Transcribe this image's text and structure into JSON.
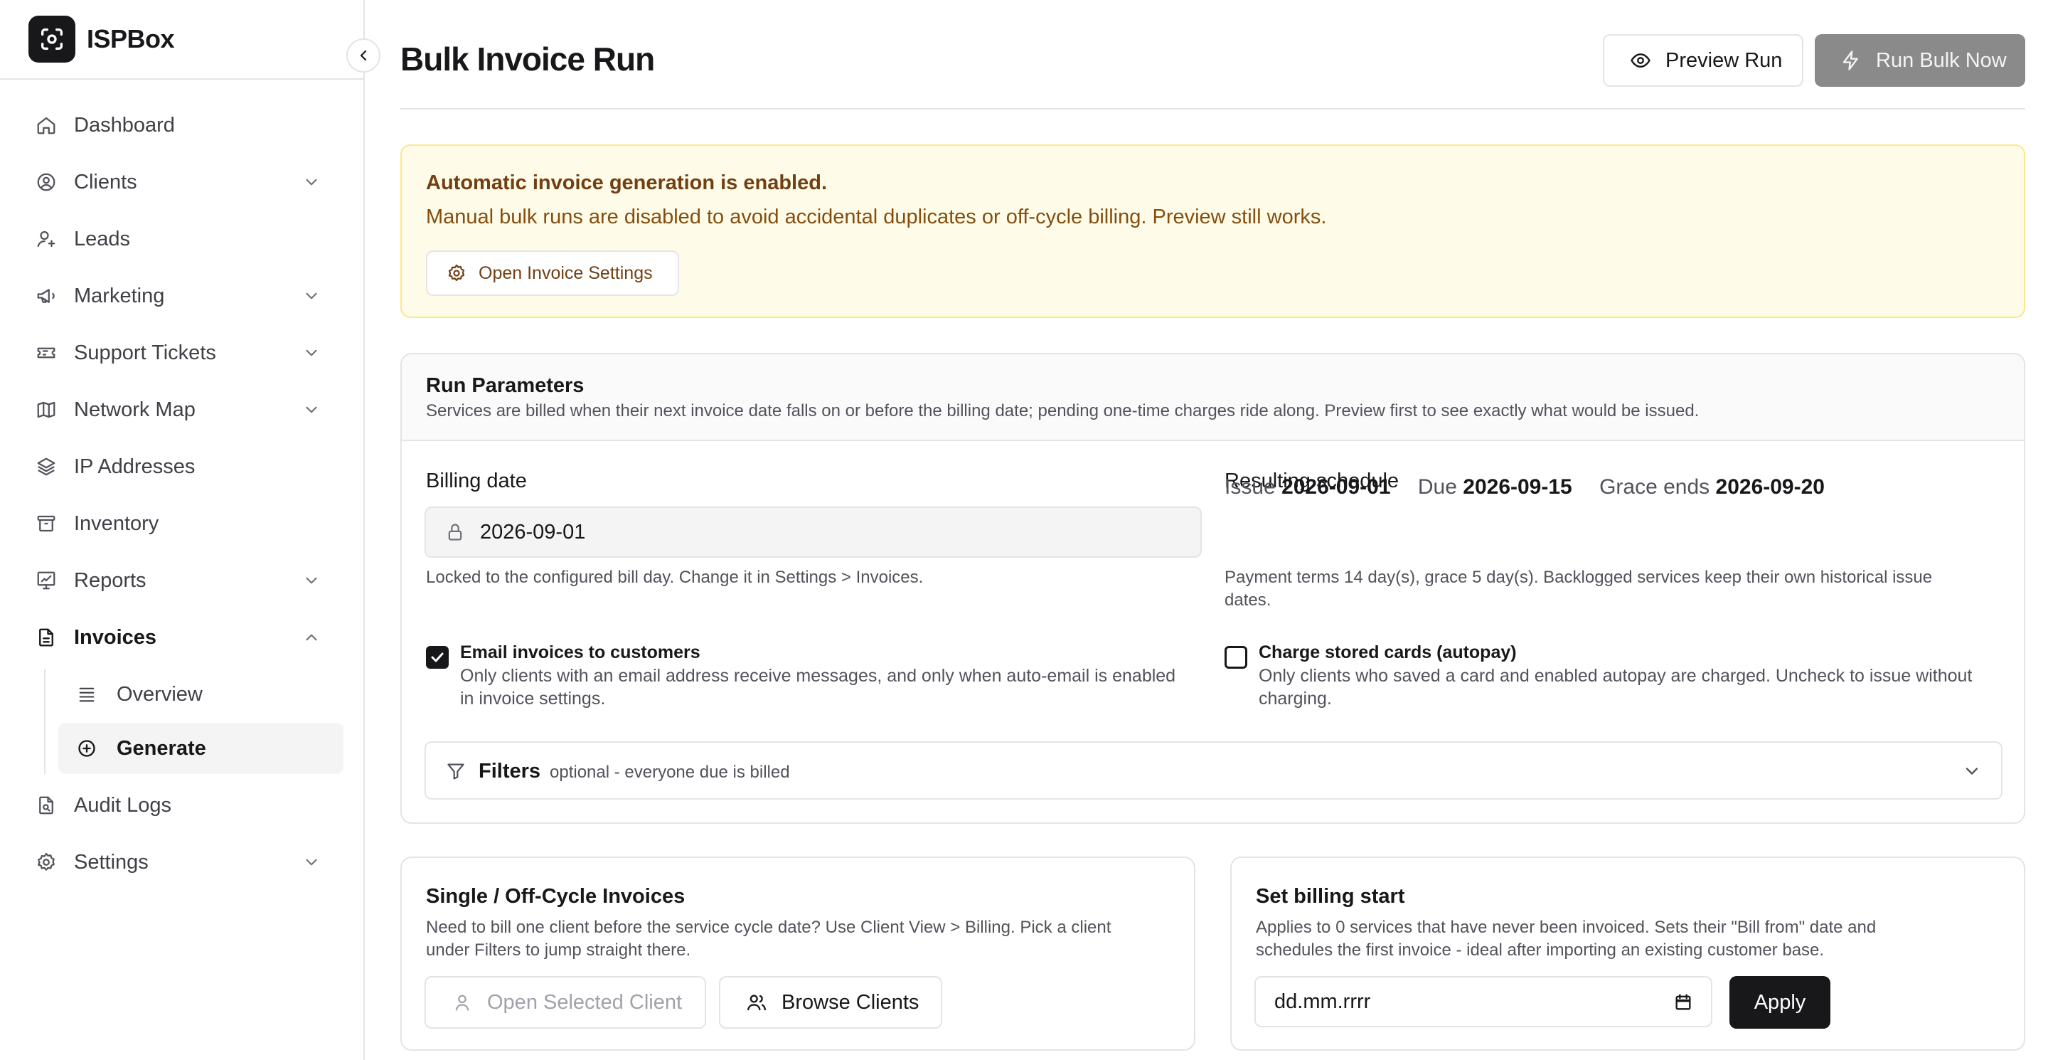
{
  "brand": {
    "name": "ISPBox"
  },
  "sidebar": {
    "items": [
      {
        "label": "Dashboard",
        "icon": "home-icon",
        "expandable": false
      },
      {
        "label": "Clients",
        "icon": "user-circle-icon",
        "expandable": true
      },
      {
        "label": "Leads",
        "icon": "user-plus-icon",
        "expandable": false
      },
      {
        "label": "Marketing",
        "icon": "megaphone-icon",
        "expandable": true
      },
      {
        "label": "Support Tickets",
        "icon": "ticket-icon",
        "expandable": true
      },
      {
        "label": "Network Map",
        "icon": "map-icon",
        "expandable": true
      },
      {
        "label": "IP Addresses",
        "icon": "layers-icon",
        "expandable": false
      },
      {
        "label": "Inventory",
        "icon": "archive-icon",
        "expandable": false
      },
      {
        "label": "Reports",
        "icon": "chart-icon",
        "expandable": true
      },
      {
        "label": "Invoices",
        "icon": "file-text-icon",
        "expandable": true,
        "open": true
      },
      {
        "label": "Audit Logs",
        "icon": "file-search-icon",
        "expandable": false
      },
      {
        "label": "Settings",
        "icon": "gear-icon",
        "expandable": true
      }
    ],
    "invoices_sub": [
      {
        "label": "Overview",
        "icon": "list-icon"
      },
      {
        "label": "Generate",
        "icon": "plus-circle-icon",
        "active": true
      }
    ]
  },
  "header": {
    "title": "Bulk Invoice Run",
    "preview_label": "Preview Run",
    "run_label": "Run Bulk Now"
  },
  "alert": {
    "title": "Automatic invoice generation is enabled.",
    "text": "Manual bulk runs are disabled to avoid accidental duplicates or off-cycle billing. Preview still works.",
    "button": "Open Invoice Settings"
  },
  "params": {
    "title": "Run Parameters",
    "subtitle": "Services are billed when their next invoice date falls on or before the billing date; pending one-time charges ride along. Preview first to see exactly what would be issued.",
    "billing_label": "Billing date",
    "billing_value": "2026-09-01",
    "billing_help": "Locked to the configured bill day. Change it in Settings > Invoices.",
    "schedule_label": "Resulting schedule",
    "issue_label": "Issue",
    "issue_value": "2026-09-01",
    "due_label": "Due",
    "due_value": "2026-09-15",
    "grace_label": "Grace ends",
    "grace_value": "2026-09-20",
    "schedule_help_1": "Payment terms 14 day(s), grace 5 day(s). Backlogged services keep their own historical issue",
    "schedule_help_2": "dates.",
    "email_title": "Email invoices to customers",
    "email_text_1": "Only clients with an email address receive messages, and only when auto-email is enabled",
    "email_text_2": "in invoice settings.",
    "email_checked": true,
    "autopay_title": "Charge stored cards (autopay)",
    "autopay_text_1": "Only clients who saved a card and enabled autopay are charged. Uncheck to issue without",
    "autopay_text_2": "charging.",
    "autopay_checked": false,
    "filters_label": "Filters",
    "filters_hint": "optional - everyone due is billed"
  },
  "single": {
    "title": "Single / Off-Cycle Invoices",
    "text_1": "Need to bill one client before the service cycle date? Use Client View > Billing. Pick a client",
    "text_2": "under Filters to jump straight there.",
    "open_label": "Open Selected Client",
    "browse_label": "Browse Clients"
  },
  "billing_start": {
    "title": "Set billing start",
    "text_1": "Applies to 0 services that have never been invoiced. Sets their \"Bill from\" date and",
    "text_2": "schedules the first invoice - ideal after importing an existing customer base.",
    "date_placeholder": "dd.mm.rrrr",
    "apply_label": "Apply"
  },
  "colors": {
    "primary": "#18181b",
    "alert_bg": "#fefce8",
    "alert_border": "#fde68a",
    "alert_text": "#854d0e",
    "disabled_button": "#8a8a8a"
  }
}
